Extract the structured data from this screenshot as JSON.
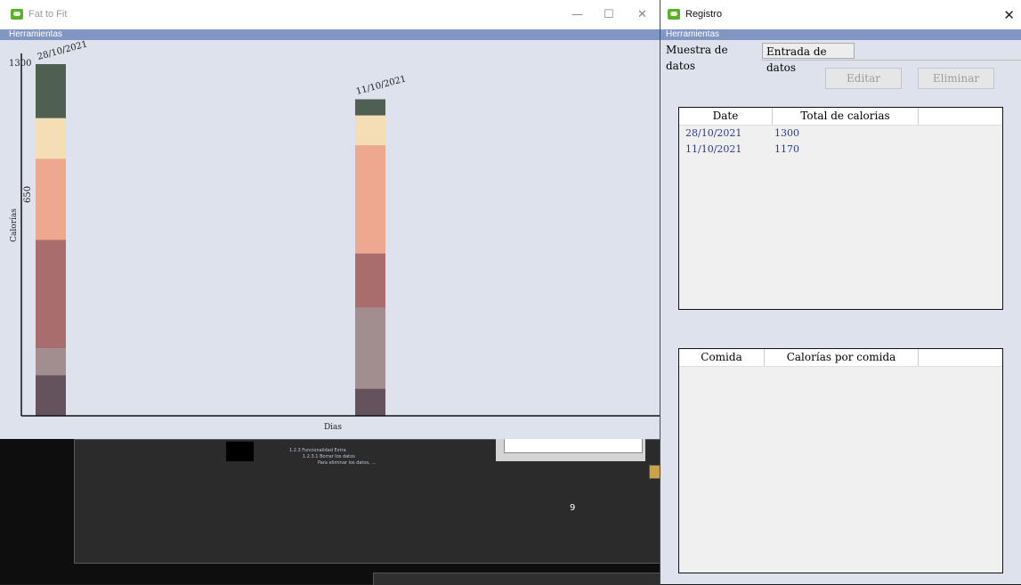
{
  "fat_window": {
    "title": "Fat to Fit",
    "menu": "Herramientas",
    "controls": {
      "minimize": "—",
      "maximize": "☐",
      "close": "✕"
    }
  },
  "chart_data": {
    "type": "bar",
    "stacked": true,
    "categories": [
      "28/10/2021",
      "11/10/2021"
    ],
    "xlabel": "Dias",
    "ylabel": "Calorías",
    "yticks": [
      "1300",
      "650"
    ],
    "ylim": [
      0,
      1300
    ],
    "segment_colors": [
      "#4f6052",
      "#f5deb6",
      "#eea88f",
      "#aa6d6d",
      "#a38e8f",
      "#64525c"
    ],
    "stacks": [
      {
        "label": "28/10/2021",
        "total": 1300,
        "segments": [
          200,
          150,
          300,
          400,
          100,
          150
        ]
      },
      {
        "label": "11/10/2021",
        "total": 1170,
        "segments": [
          60,
          110,
          400,
          200,
          300,
          100
        ]
      }
    ]
  },
  "background": {
    "doc_line1": "1.2.3 Funcionalidad Extra",
    "doc_line2": "1.2.3.1 Borrar los datos",
    "doc_line3": "Para eliminar los datos, ...",
    "page_number": "9"
  },
  "registro_window": {
    "title": "Registro",
    "menu": "Herramientas",
    "close": "✕",
    "tabs": [
      {
        "label": "Muestra de datos",
        "active": true
      },
      {
        "label": "Entrada de datos",
        "active": false
      }
    ],
    "buttons": {
      "edit": "Editar",
      "delete": "Eliminar"
    },
    "records_table": {
      "headers": [
        "Date",
        "Total de calorias"
      ],
      "rows": [
        {
          "date": "28/10/2021",
          "total": "1300"
        },
        {
          "date": "11/10/2021",
          "total": "1170"
        }
      ]
    },
    "meals_table": {
      "headers": [
        "Comida",
        "Calorías por comida"
      ]
    }
  }
}
